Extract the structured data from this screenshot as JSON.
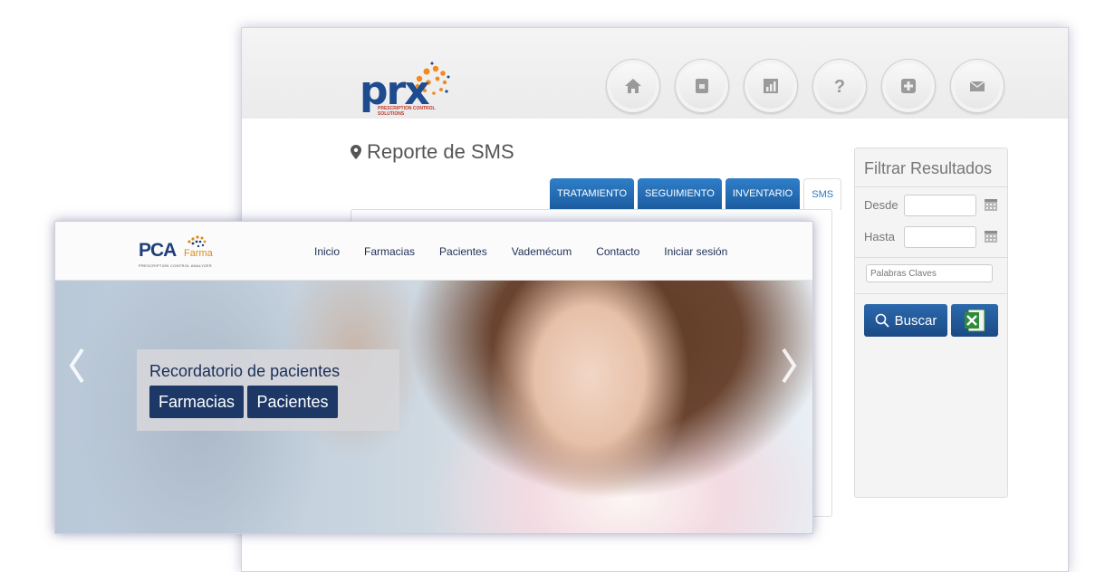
{
  "back_app": {
    "logo": {
      "text": "prx",
      "subtext": "PRESCRIPTION CONTROL SOLUTIONS"
    },
    "nav_icons": [
      "home-icon",
      "contacts-icon",
      "chart-icon",
      "help-icon",
      "plus-icon",
      "mail-icon"
    ],
    "report_title": "Reporte de SMS",
    "tabs": [
      {
        "label": "TRATAMIENTO",
        "active": false
      },
      {
        "label": "SEGUIMIENTO",
        "active": false
      },
      {
        "label": "INVENTARIO",
        "active": false
      },
      {
        "label": "SMS",
        "active": true
      }
    ],
    "filter": {
      "title": "Filtrar Resultados",
      "desde_label": "Desde",
      "desde_value": "",
      "hasta_label": "Hasta",
      "hasta_value": "",
      "keywords_placeholder": "Palabras Claves",
      "search_label": "Buscar",
      "excel_icon": "excel-icon"
    }
  },
  "front_app": {
    "logo": {
      "main": "PCA",
      "accent": "Farma",
      "subtext": "PRESCRIPTION CONTROL ANALYZER"
    },
    "menu": [
      "Inicio",
      "Farmacias",
      "Pacientes",
      "Vademécum",
      "Contacto",
      "Iniciar sesión"
    ],
    "hero": {
      "caption_title": "Recordatorio de pacientes",
      "buttons": [
        "Farmacias",
        "Pacientes"
      ]
    }
  },
  "colors": {
    "brand_blue": "#1e4b8f",
    "tab_blue": "#1d5da1",
    "accent_orange": "#e08a1c"
  }
}
